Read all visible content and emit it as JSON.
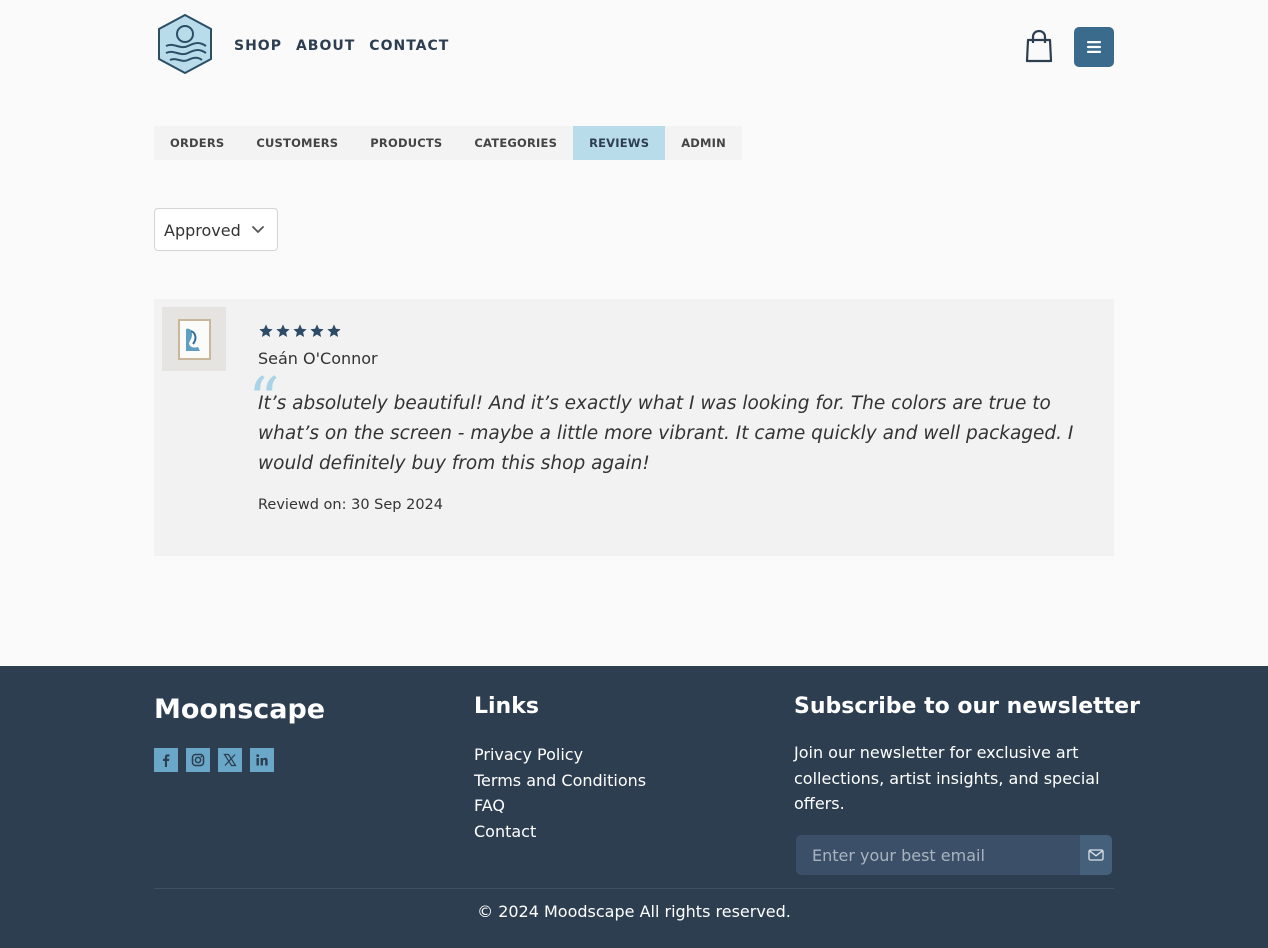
{
  "header": {
    "nav": [
      {
        "label": "SHOP"
      },
      {
        "label": "ABOUT"
      },
      {
        "label": "CONTACT"
      }
    ]
  },
  "admin_tabs": [
    {
      "label": "ORDERS",
      "active": false
    },
    {
      "label": "CUSTOMERS",
      "active": false
    },
    {
      "label": "PRODUCTS",
      "active": false
    },
    {
      "label": "CATEGORIES",
      "active": false
    },
    {
      "label": "REVIEWS",
      "active": true
    },
    {
      "label": "ADMIN",
      "active": false
    }
  ],
  "filter": {
    "selected": "Approved"
  },
  "review": {
    "rating": 5,
    "max_rating": 5,
    "reviewer": "Seán O'Connor",
    "text": "It’s absolutely beautiful! And it’s exactly what I was looking for. The colors are true to what’s on the screen - maybe a little more vibrant. It came quickly and well packaged. I would definitely buy from this shop again!",
    "date": "Reviewd on: 30 Sep 2024"
  },
  "footer": {
    "brand": "Moonscape",
    "socials": [
      "facebook-icon",
      "instagram-icon",
      "x-icon",
      "linkedin-icon"
    ],
    "links_title": "Links",
    "links": [
      "Privacy Policy",
      "Terms and Conditions",
      "FAQ",
      "Contact"
    ],
    "newsletter_title": "Subscribe to our newsletter",
    "newsletter_text": "Join our newsletter for exclusive art collections, artist insights, and special offers.",
    "email_placeholder": "Enter your best email",
    "copyright": "© 2024 Moodscape All rights reserved."
  },
  "colors": {
    "primary": "#2c3e50",
    "accent": "#3a6b8c",
    "active_tab": "#b9dceb",
    "social": "#6aa7c8"
  }
}
